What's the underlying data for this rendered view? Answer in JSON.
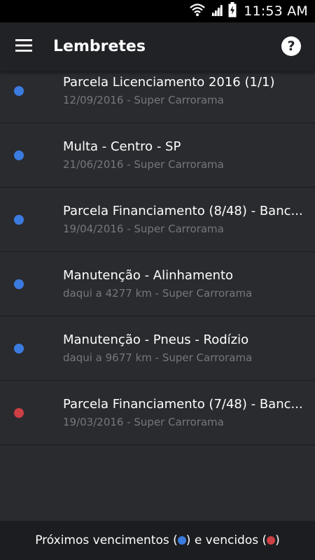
{
  "status_bar": {
    "time": "11:53 AM",
    "icons": [
      "wifi-icon",
      "signal-icon",
      "battery-icon"
    ]
  },
  "app_bar": {
    "title": "Lembretes",
    "menu_icon": "hamburger-menu-icon",
    "help_icon": "help-icon",
    "help_glyph": "?"
  },
  "colors": {
    "upcoming": "#3b7be0",
    "overdue": "#cc3f44",
    "background": "#2a2b2f",
    "app_bar": "#212226",
    "footer": "#1c1d20"
  },
  "reminders": [
    {
      "title": "Parcela Licenciamento 2016 (1/1)",
      "subtitle": "12/09/2016 - Super Carrorama",
      "status": "upcoming"
    },
    {
      "title": "Multa - Centro - SP",
      "subtitle": "21/06/2016 - Super Carrorama",
      "status": "upcoming"
    },
    {
      "title": "Parcela Financiamento (8/48) - Banc...",
      "subtitle": "19/04/2016 - Super Carrorama",
      "status": "upcoming"
    },
    {
      "title": "Manutenção - Alinhamento",
      "subtitle": "daqui a 4277 km - Super Carrorama",
      "status": "upcoming"
    },
    {
      "title": "Manutenção - Pneus - Rodízio",
      "subtitle": "daqui a 9677 km - Super Carrorama",
      "status": "upcoming"
    },
    {
      "title": "Parcela Financiamento (7/48) - Banc...",
      "subtitle": "19/03/2016 - Super Carrorama",
      "status": "overdue"
    }
  ],
  "footer": {
    "text_before": "Próximos vencimentos (",
    "text_middle": ") e vencidos (",
    "text_after": ")"
  }
}
